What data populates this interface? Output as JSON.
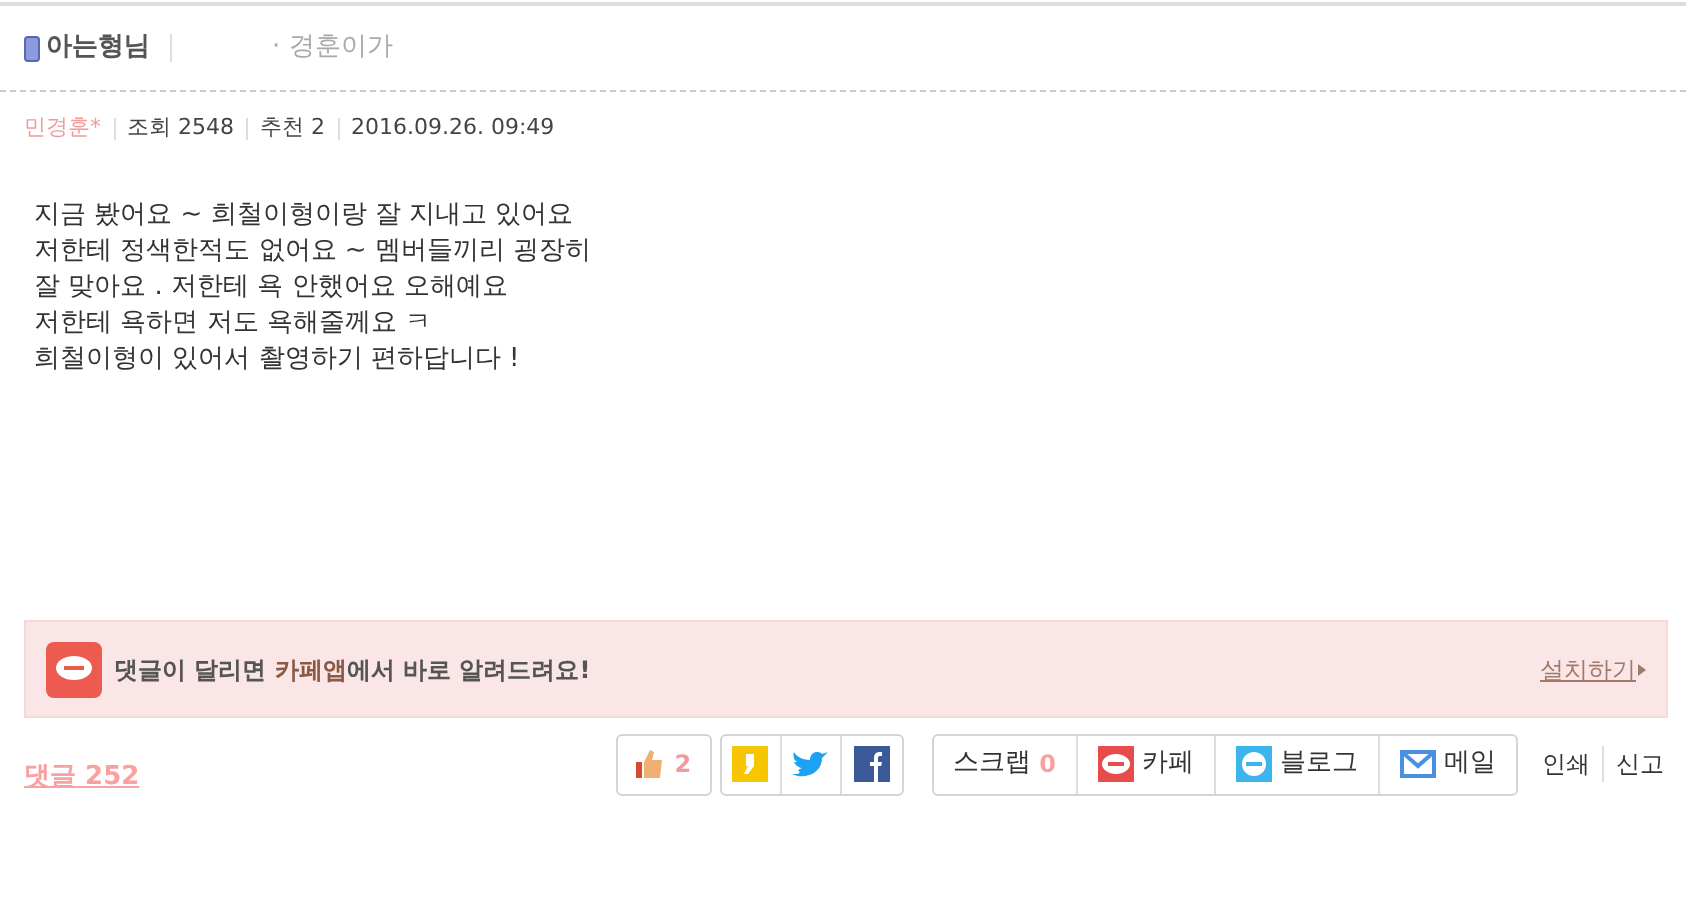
{
  "header": {
    "title": "아는형님",
    "category": "· 경훈이가"
  },
  "meta": {
    "author": "민경훈*",
    "views": "조회 2548",
    "recommend": "추천 2",
    "date": "2016.09.26. 09:49"
  },
  "body": [
    "지금 봤어요 ~ 희철이형이랑 잘 지내고 있어요",
    "저한테 정색한적도 없어요 ~ 멤버들끼리 굉장히",
    "잘 맞아요 . 저한테 욕 안했어요 오해예요",
    "저한테 욕하면 저도 욕해줄께요 ㅋ",
    "희철이형이 있어서 촬영하기 편하답니다 !"
  ],
  "banner": {
    "parts": [
      {
        "text": "댓글이 달리면 ",
        "highlight": false
      },
      {
        "text": "카페앱",
        "highlight": true
      },
      {
        "text": "에서 바로 알려드려요!",
        "highlight": false
      }
    ],
    "link": "설치하기"
  },
  "comments": "댓글 252",
  "like": {
    "count": "2"
  },
  "share": [
    {
      "kind": "scrap",
      "label": "스크랩",
      "count": "0"
    },
    {
      "kind": "cafe",
      "label": "카페"
    },
    {
      "kind": "blog",
      "label": "블로그"
    },
    {
      "kind": "mail",
      "label": "메일"
    }
  ],
  "actions": [
    "인쇄",
    "신고"
  ]
}
